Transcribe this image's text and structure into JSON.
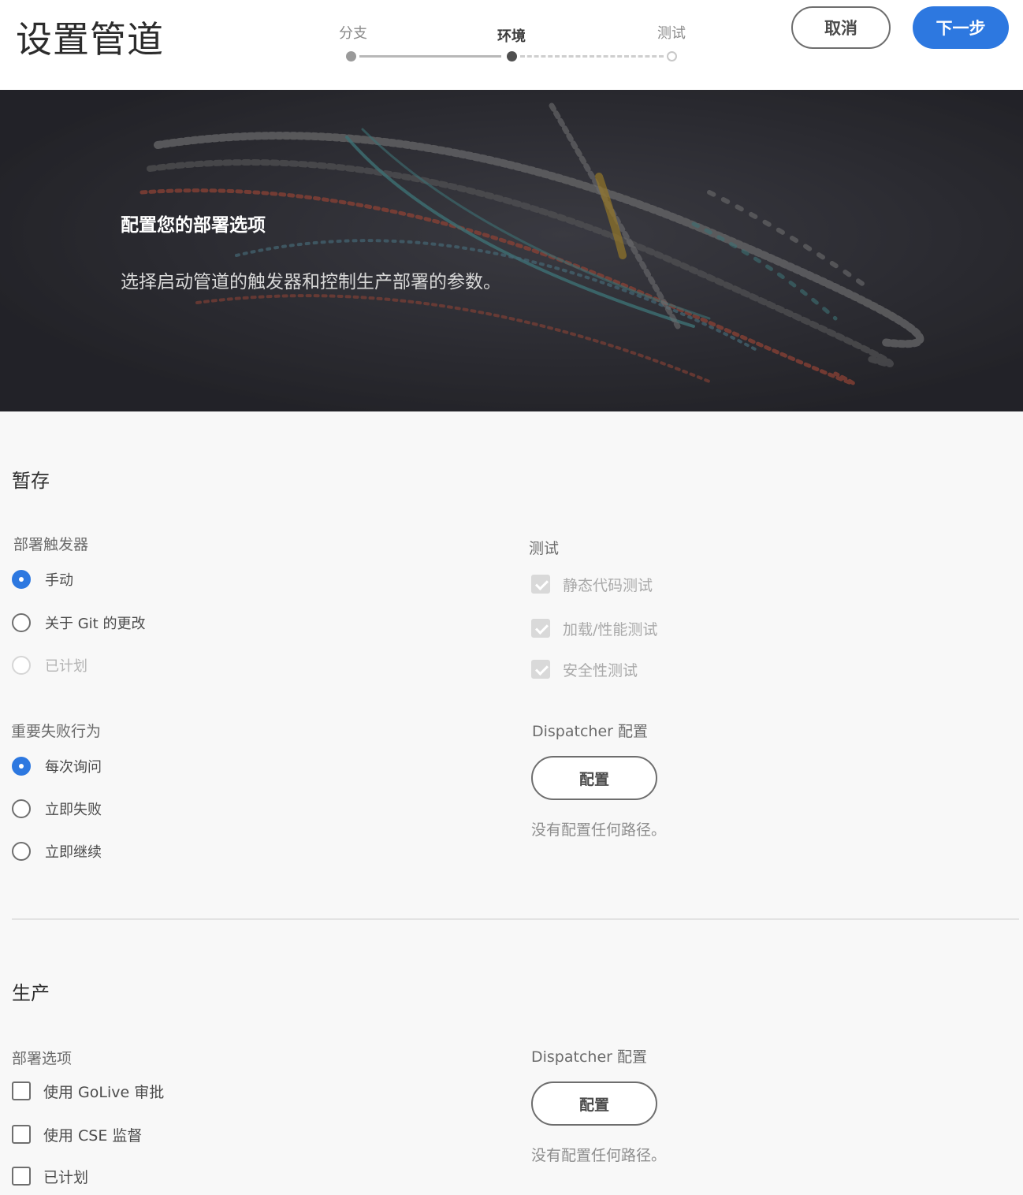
{
  "header": {
    "title": "设置管道",
    "steps": [
      {
        "label": "分支",
        "state": "done"
      },
      {
        "label": "环境",
        "state": "current"
      },
      {
        "label": "测试",
        "state": "upcoming"
      }
    ],
    "cancel_label": "取消",
    "next_label": "下一步"
  },
  "hero": {
    "title": "配置您的部署选项",
    "subtitle": "选择启动管道的触发器和控制生产部署的参数。"
  },
  "staging": {
    "title": "暂存",
    "trigger": {
      "label": "部署触发器",
      "options": [
        {
          "label": "手动",
          "checked": true,
          "disabled": false
        },
        {
          "label": "关于 Git 的更改",
          "checked": false,
          "disabled": false
        },
        {
          "label": "已计划",
          "checked": false,
          "disabled": true
        }
      ]
    },
    "failure": {
      "label": "重要失败行为",
      "options": [
        {
          "label": "每次询问",
          "checked": true
        },
        {
          "label": "立即失败",
          "checked": false
        },
        {
          "label": "立即继续",
          "checked": false
        }
      ]
    },
    "tests": {
      "label": "测试",
      "items": [
        {
          "label": "静态代码测试",
          "checked": true,
          "disabled": true
        },
        {
          "label": "加载/性能测试",
          "checked": true,
          "disabled": true
        },
        {
          "label": "安全性测试",
          "checked": true,
          "disabled": true
        }
      ]
    },
    "dispatcher": {
      "label": "Dispatcher 配置",
      "button_label": "配置",
      "status": "没有配置任何路径。"
    }
  },
  "production": {
    "title": "生产",
    "options": {
      "label": "部署选项",
      "items": [
        {
          "label": "使用 GoLive 审批",
          "checked": false
        },
        {
          "label": "使用 CSE 监督",
          "checked": false
        },
        {
          "label": "已计划",
          "checked": false
        }
      ]
    },
    "dispatcher": {
      "label": "Dispatcher 配置",
      "button_label": "配置",
      "status": "没有配置任何路径。"
    }
  },
  "colors": {
    "accent": "#2d78e0",
    "hero_bg": "#2a2a30"
  }
}
